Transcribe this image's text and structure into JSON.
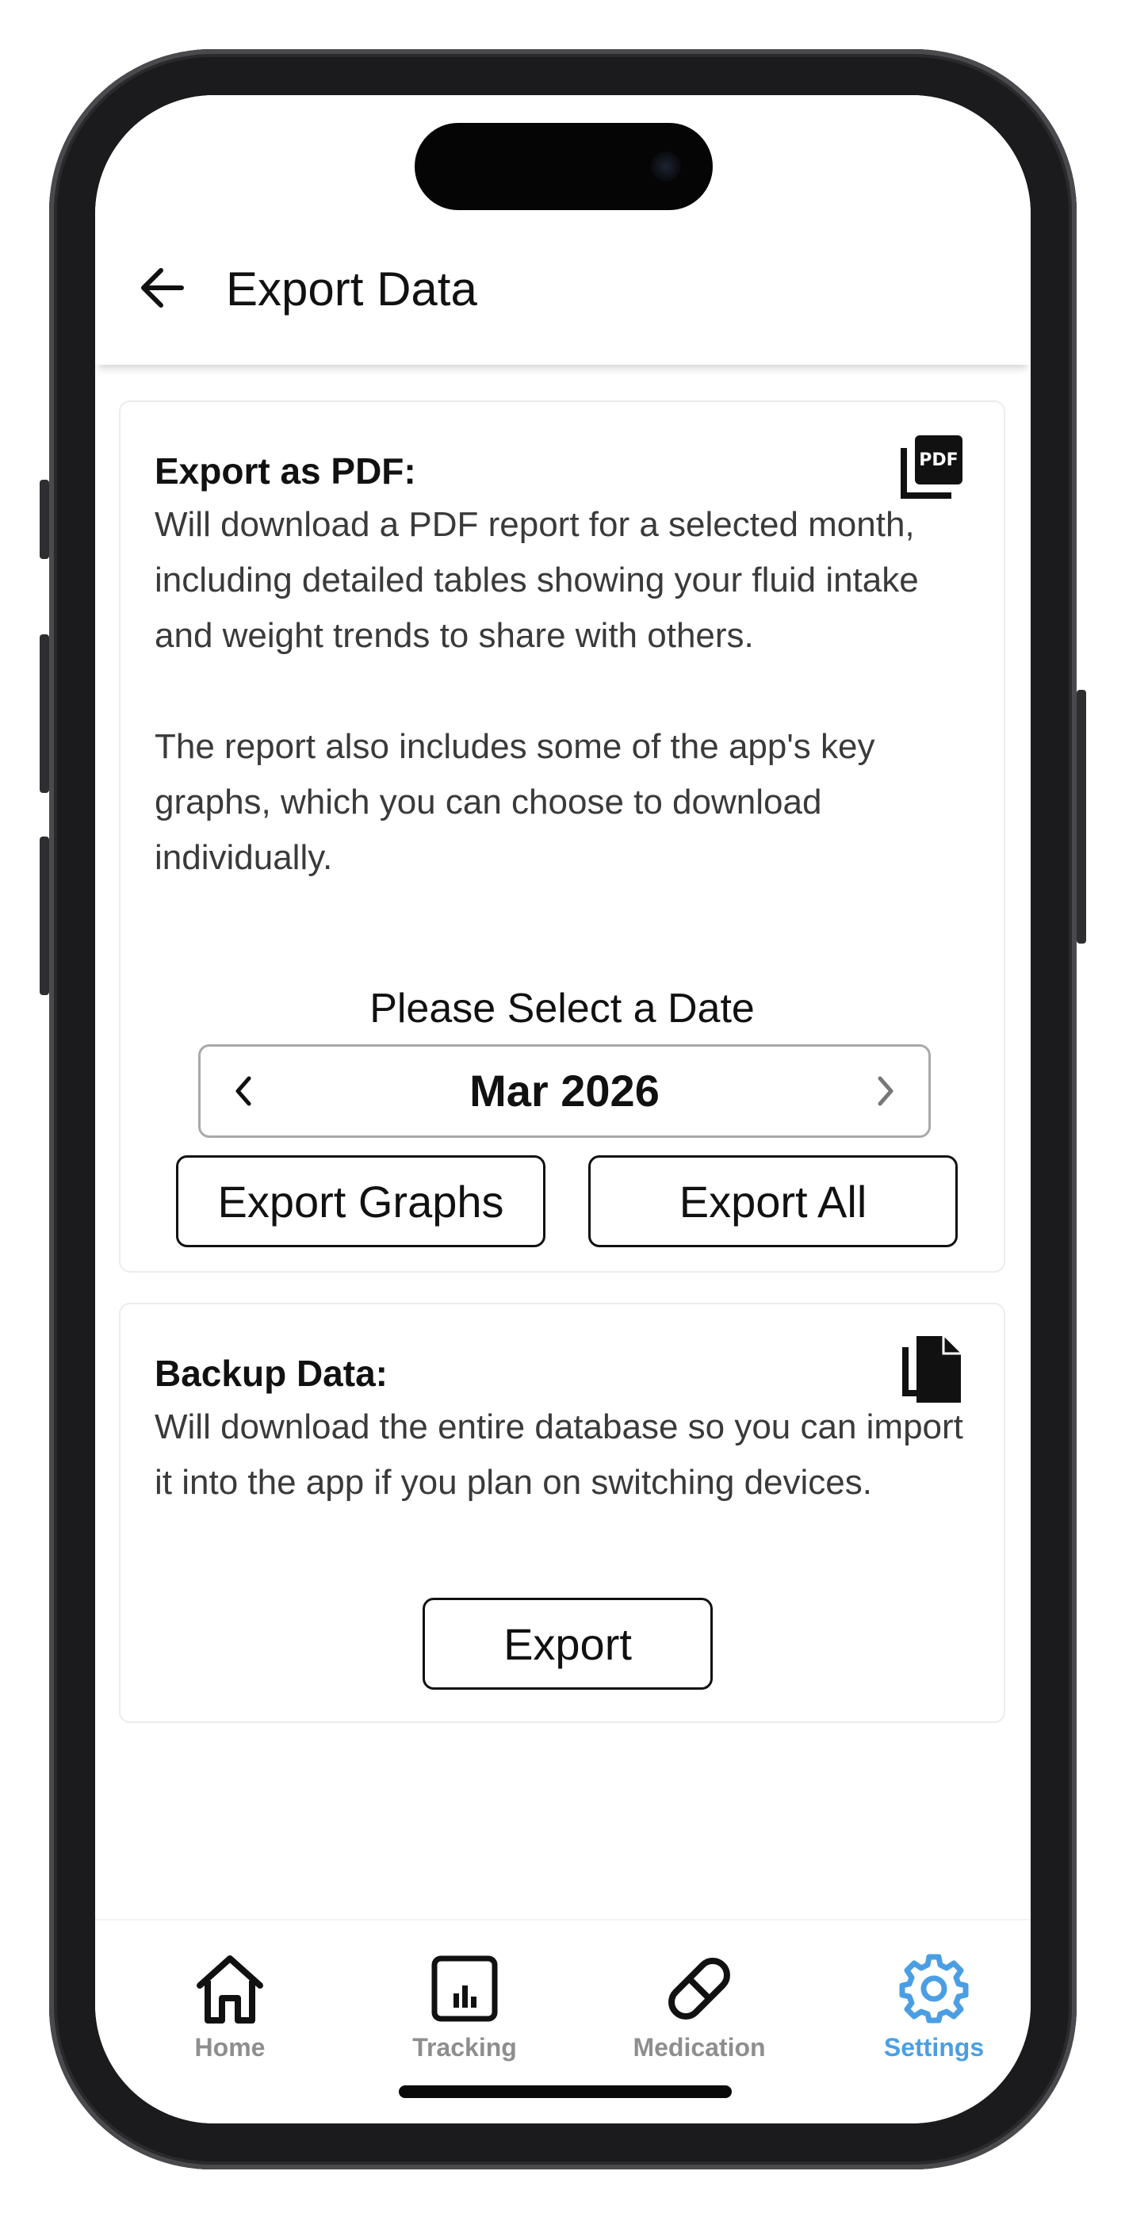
{
  "header": {
    "title": "Export Data",
    "back_icon": "arrow-left-icon"
  },
  "pdf_card": {
    "title": "Export as PDF:",
    "icon": "pdf-file-icon",
    "icon_text": "PDF",
    "description": "Will download a PDF report for a selected month, including detailed tables showing your fluid intake and weight trends to share with others.\n\nThe report also includes some of the app's key graphs, which you can choose to download individually.",
    "date_label": "Please Select a Date",
    "month_picker": {
      "value": "Mar 2026",
      "prev_icon": "chevron-left-icon",
      "next_icon": "chevron-right-icon"
    },
    "export_graphs_label": "Export Graphs",
    "export_all_label": "Export All"
  },
  "backup_card": {
    "title": "Backup Data:",
    "icon": "copy-file-icon",
    "description": "Will download the entire database so you can import it into the app if you plan on switching devices.",
    "export_label": "Export"
  },
  "tabbar": {
    "active_color": "#4a9fe4",
    "inactive_color": "#8e8e8e",
    "tabs": [
      {
        "label": "Home",
        "icon": "home-icon",
        "active": false
      },
      {
        "label": "Tracking",
        "icon": "chart-icon",
        "active": false
      },
      {
        "label": "Medication",
        "icon": "pill-icon",
        "active": false
      },
      {
        "label": "Settings",
        "icon": "gear-icon",
        "active": true
      }
    ]
  }
}
